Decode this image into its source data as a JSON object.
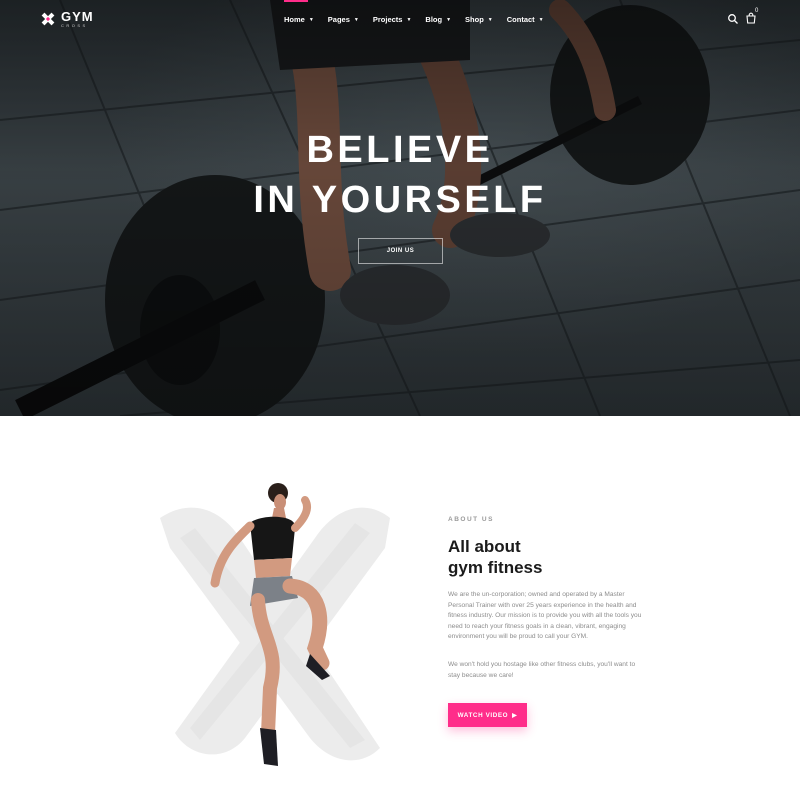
{
  "brand": {
    "name": "GYM",
    "tagline": "CROSS"
  },
  "nav": {
    "items": [
      {
        "label": "Home"
      },
      {
        "label": "Pages"
      },
      {
        "label": "Projects"
      },
      {
        "label": "Blog"
      },
      {
        "label": "Shop"
      },
      {
        "label": "Contact"
      }
    ],
    "caret_icon": "chevron-down-icon",
    "search_icon": "search-icon",
    "cart_icon": "shopping-bag-icon",
    "cart_count": "0"
  },
  "hero": {
    "title_line1": "BELIEVE",
    "title_line2": "IN YOURSELF",
    "cta_label": "JOIN US"
  },
  "about": {
    "eyebrow": "ABOUT US",
    "title_line1": "All about",
    "title_line2": "gym fitness",
    "paragraph1": "We are the un-corporation; owned and operated by a Master Personal Trainer with over 25 years experience in the health and fitness industry. Our mission is to provide you with all the tools you need to reach your fitness goals in a clean, vibrant, engaging environment you will be proud to call your GYM.",
    "paragraph2": "We won't hold you hostage like other fitness clubs, you'll want to stay because we care!",
    "cta_label": "WATCH VIDEO",
    "cta_icon": "play-icon"
  },
  "colors": {
    "accent": "#ff2d8a",
    "hero_dark": "#2b3236",
    "heading": "#1b1b1b",
    "body_text": "#8d8d8d"
  }
}
